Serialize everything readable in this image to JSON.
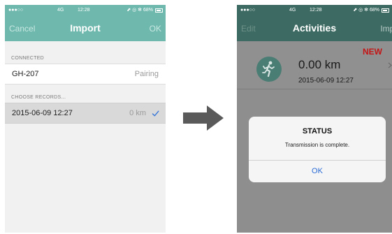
{
  "import_screen": {
    "status_bar": {
      "carrier": "●●●○○",
      "network": "4G",
      "time": "12:28",
      "right": "⬈ ◎ ✻ 68%"
    },
    "nav": {
      "cancel_label": "Cancel",
      "title": "Import",
      "ok_label": "OK"
    },
    "connected_header": "CONNECTED",
    "device": {
      "name": "GH-207",
      "status": "Pairing"
    },
    "records_header": "CHOOSE RECORDS...",
    "records": [
      {
        "date": "2015-06-09 12:27",
        "distance": "0 km",
        "selected": true
      }
    ]
  },
  "activities_screen": {
    "status_bar": {
      "carrier": "●●●○○",
      "network": "4G",
      "time": "12:28",
      "right": "⬈ ◎ ✻ 68%"
    },
    "nav": {
      "edit_label": "Edit",
      "title": "Activities",
      "import_label": "Impo"
    },
    "activity": {
      "distance": "0.00 km",
      "date": "2015-06-09 12:27",
      "badge": "NEW",
      "icon": "running-person-icon"
    },
    "alert": {
      "title": "STATUS",
      "message": "Transmission is complete.",
      "button_label": "OK"
    }
  },
  "colors": {
    "accent": "#6fb8ad",
    "accent_dimmed": "#3d6b63",
    "badge_red": "#c41616",
    "alert_button_blue": "#2a6bd6",
    "checkmark_blue": "#3a78d8"
  }
}
